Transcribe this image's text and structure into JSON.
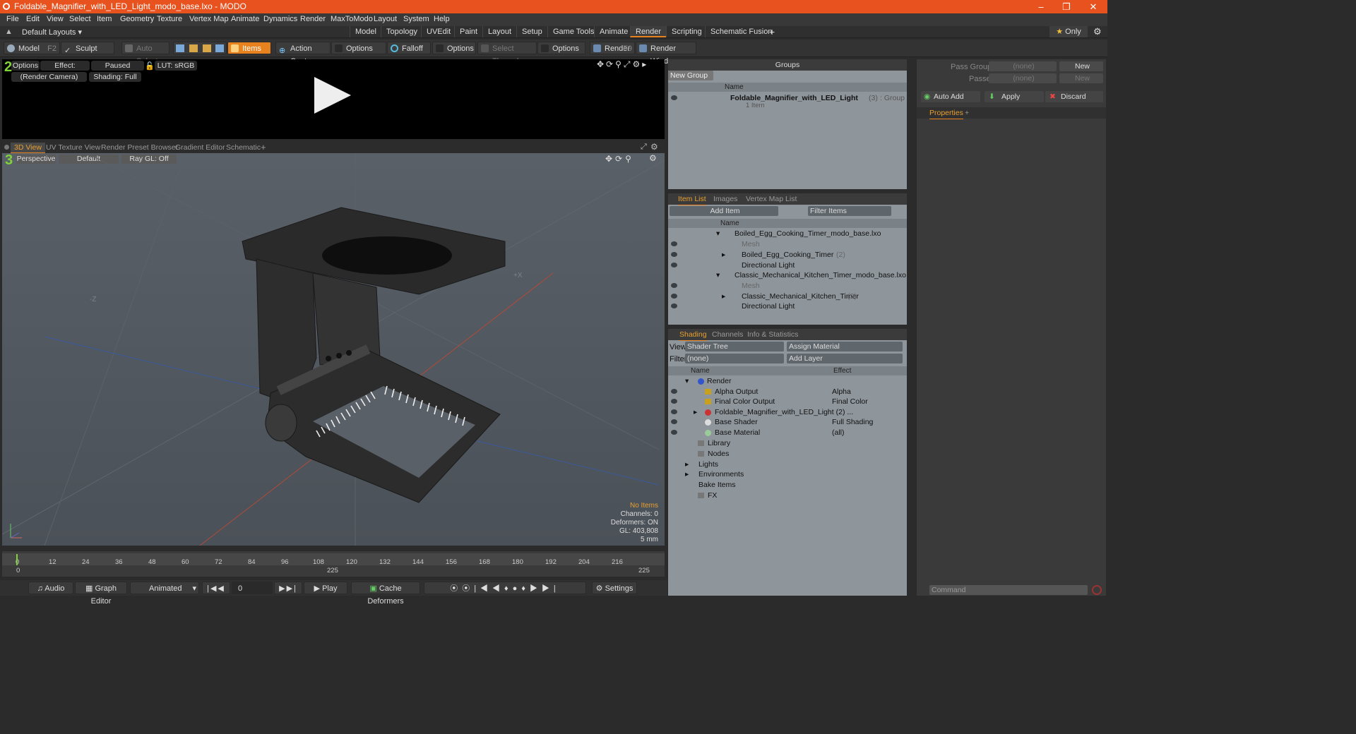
{
  "window": {
    "title": "Foldable_Magnifier_with_LED_Light_modo_base.lxo - MODO"
  },
  "menu": [
    "File",
    "Edit",
    "View",
    "Select",
    "Item",
    "Geometry",
    "Texture",
    "Vertex Map",
    "Animate",
    "Dynamics",
    "Render",
    "MaxToModo",
    "Layout",
    "System",
    "Help"
  ],
  "layouts": {
    "selector": "Default Layouts",
    "tabs": [
      "Model",
      "Topology",
      "UVEdit",
      "Paint",
      "Layout",
      "Setup",
      "Game Tools",
      "Animate",
      "Render",
      "Scripting",
      "Schematic Fusion"
    ],
    "active": "Render",
    "only_label": "Only"
  },
  "toolbar": {
    "model": "Model",
    "model_key": "F2",
    "sculpt": "Sculpt",
    "auto_select": "Auto Select",
    "items": "Items",
    "action_center": "Action Center",
    "options1": "Options",
    "falloff": "Falloff",
    "options2": "Options",
    "select_through": "Select Through",
    "options3": "Options",
    "render": "Render",
    "render_key": "F9",
    "render_window": "Render Window"
  },
  "render_view": {
    "options": "Options",
    "effect": "Effect: (Shadi...",
    "paused": "Paused",
    "lut": "LUT: sRGB",
    "camera": "(Render Camera)",
    "shading": "Shading: Full"
  },
  "viewport_tabs": [
    "3D View",
    "UV Texture View",
    "Render Preset Browser",
    "Gradient Editor",
    "Schematic"
  ],
  "viewport": {
    "perspective": "Perspective",
    "default": "Default",
    "raygl": "Ray GL: Off",
    "stats": {
      "items": "No Items",
      "channels": "Channels: 0",
      "deformers": "Deformers: ON",
      "gl": "GL: 403,808",
      "unit": "5 mm"
    }
  },
  "timeline": {
    "ticks": [
      "0",
      "12",
      "24",
      "36",
      "48",
      "60",
      "72",
      "84",
      "96",
      "108",
      "120",
      "132",
      "144",
      "156",
      "168",
      "180",
      "192",
      "204",
      "216"
    ],
    "end": "225",
    "mid": "225"
  },
  "transport": {
    "audio": "Audio",
    "graph_editor": "Graph Editor",
    "animated": "Animated",
    "frame": "0",
    "play": "Play",
    "cache": "Cache Deformers",
    "settings": "Settings"
  },
  "groups": {
    "title": "Groups",
    "new_group": "New Group",
    "col_name": "Name",
    "item_name": "Foldable_Magnifier_with_LED_Light",
    "item_count": "(3)",
    "item_type": ": Group",
    "item_sub": "1 Item"
  },
  "item_list": {
    "tabs": [
      "Item List",
      "Images",
      "Vertex Map List"
    ],
    "add_item": "Add Item",
    "filter": "Filter Items",
    "col_name": "Name",
    "rows": [
      {
        "label": "Boiled_Egg_Cooking_Timer_modo_base.lxo",
        "count": ""
      },
      {
        "label": "Mesh",
        "count": ""
      },
      {
        "label": "Boiled_Egg_Cooking_Timer",
        "count": "(2)"
      },
      {
        "label": "Directional Light",
        "count": ""
      },
      {
        "label": "Classic_Mechanical_Kitchen_Timer_modo_base.lxo",
        "count": ""
      },
      {
        "label": "Mesh",
        "count": ""
      },
      {
        "label": "Classic_Mechanical_Kitchen_Timer",
        "count": "(2)"
      },
      {
        "label": "Directional Light",
        "count": ""
      }
    ]
  },
  "shading": {
    "tabs": [
      "Shading",
      "Channels",
      "Info & Statistics"
    ],
    "view_label": "View",
    "view_value": "Shader Tree",
    "assign": "Assign Material",
    "filter_label": "Filter",
    "filter_value": "(none)",
    "add_layer": "Add Layer",
    "col_name": "Name",
    "col_effect": "Effect",
    "rows": [
      {
        "name": "Render",
        "effect": ""
      },
      {
        "name": "Alpha Output",
        "effect": "Alpha"
      },
      {
        "name": "Final Color Output",
        "effect": "Final Color"
      },
      {
        "name": "Foldable_Magnifier_with_LED_Light (2) ...",
        "effect": ""
      },
      {
        "name": "Base Shader",
        "effect": "Full Shading"
      },
      {
        "name": "Base Material",
        "effect": "(all)"
      },
      {
        "name": "Library",
        "effect": ""
      },
      {
        "name": "Nodes",
        "effect": ""
      },
      {
        "name": "Lights",
        "effect": ""
      },
      {
        "name": "Environments",
        "effect": ""
      },
      {
        "name": "Bake Items",
        "effect": ""
      },
      {
        "name": "FX",
        "effect": ""
      }
    ]
  },
  "right": {
    "pass_groups": "Pass Groups",
    "passes": "Passes",
    "none": "(none)",
    "new": "New",
    "auto_add": "Auto Add",
    "apply": "Apply",
    "discard": "Discard",
    "properties": "Properties",
    "command": "Command"
  },
  "colors": {
    "accent": "#e8821f",
    "titlebar": "#e8521f"
  }
}
